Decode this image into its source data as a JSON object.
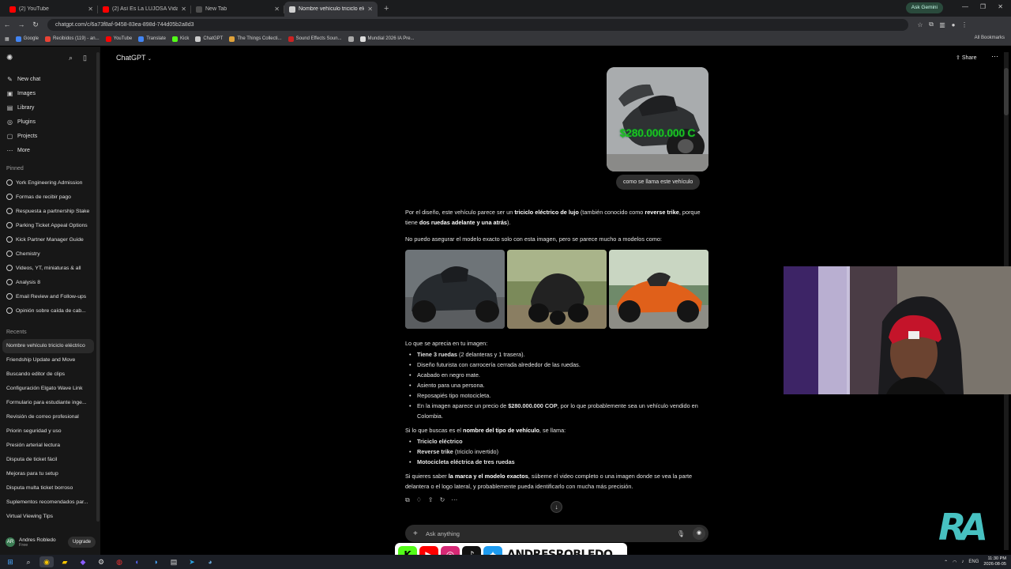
{
  "browser": {
    "tabs": [
      {
        "title": "(2) YouTube",
        "color": "#ff0000"
      },
      {
        "title": "(2) Así Es La LUJOSA Vida De...",
        "color": "#ff0000"
      },
      {
        "title": "New Tab",
        "color": "#4d4d4d"
      },
      {
        "title": "Nombre vehículo triciclo eléctr...",
        "color": "#d0d0d0",
        "active": true
      }
    ],
    "ask_gemini": "Ask Gemini",
    "url": "chatgpt.com/c/6a73f8af-9458-83ea-898d-744d05b2a8d3",
    "bookmarks": [
      {
        "label": "Google",
        "color": "#4285f4"
      },
      {
        "label": "Recibidos (119) - an...",
        "color": "#ea4335"
      },
      {
        "label": "YouTube",
        "color": "#ff0000"
      },
      {
        "label": "Translate",
        "color": "#4285f4"
      },
      {
        "label": "Kick",
        "color": "#53fc18"
      },
      {
        "label": "ChatGPT",
        "color": "#cccccc"
      },
      {
        "label": "The Things Collecti...",
        "color": "#e0a23a"
      },
      {
        "label": "Sound Effects Soun...",
        "color": "#cc2222"
      },
      {
        "label": "",
        "color": "#aaaaaa"
      },
      {
        "label": "Mundial 2026 IA Pre...",
        "color": "#dddddd"
      }
    ],
    "all_bookmarks": "All Bookmarks"
  },
  "sidebar": {
    "nav": [
      {
        "label": "New chat",
        "icon": "✎"
      },
      {
        "label": "Images",
        "icon": "▣"
      },
      {
        "label": "Library",
        "icon": "▤"
      },
      {
        "label": "Plugins",
        "icon": "◎"
      },
      {
        "label": "Projects",
        "icon": "▢"
      },
      {
        "label": "More",
        "icon": "⋯"
      }
    ],
    "pinned_heading": "Pinned",
    "pinned": [
      "York Engineering Admission",
      "Formas de recibir pago",
      "Respuesta a partnership Stake",
      "Parking Ticket Appeal Options",
      "Kick Partner Manager Guide",
      "Chemistry",
      "Videos, YT, miniaturas & all",
      "Analysis 8",
      "Email Review and Follow-ups",
      "Opinión sobre caída de cab..."
    ],
    "recents_heading": "Recents",
    "recents": [
      "Nombre vehículo triciclo eléctrico",
      "Friendship Update and Move",
      "Buscando editor de clips",
      "Configuración Elgato Wave Link",
      "Formulario para estudiante inge...",
      "Revisión de correo profesional",
      "Priorin seguridad y uso",
      "Presión arterial lectura",
      "Disputa de ticket fácil",
      "Mejoras para tu setup",
      "Disputa multa ticket borroso",
      "Suplementos recomendados par...",
      "Virtual Viewing Tips"
    ],
    "user": {
      "name": "Andres Robledo",
      "plan": "Free",
      "initials": "AR",
      "upgrade": "Upgrade"
    }
  },
  "header": {
    "model": "ChatGPT",
    "share": "Share"
  },
  "chat": {
    "image_price": "$280.000.000 C",
    "user_message": "como se llama este vehículo",
    "p1": [
      {
        "t": "Por el diseño, este vehículo parece ser un ",
        "b": false
      },
      {
        "t": "triciclo eléctrico de lujo",
        "b": true
      },
      {
        "t": " (también conocido como ",
        "b": false
      },
      {
        "t": "reverse trike",
        "b": true
      },
      {
        "t": ", porque tiene ",
        "b": false
      },
      {
        "t": "dos ruedas adelante y una atrás",
        "b": true
      },
      {
        "t": ").",
        "b": false
      }
    ],
    "p2": "No puedo asegurar el modelo exacto solo con esta imagen, pero se parece mucho a modelos como:",
    "p3": "Lo que se aprecia en tu imagen:",
    "features": [
      [
        {
          "t": "Tiene ",
          "b": true
        },
        {
          "t": "3 ruedas",
          "b": true
        },
        {
          "t": " (2 delanteras y 1 trasera).",
          "b": false
        }
      ],
      [
        {
          "t": "Diseño futurista con carrocería cerrada alrededor de las ruedas.",
          "b": false
        }
      ],
      [
        {
          "t": "Acabado en negro mate.",
          "b": false
        }
      ],
      [
        {
          "t": "Asiento para una persona.",
          "b": false
        }
      ],
      [
        {
          "t": "Reposapiés tipo motocicleta.",
          "b": false
        }
      ],
      [
        {
          "t": "En la imagen aparece un precio de ",
          "b": false
        },
        {
          "t": "$280.000.000 COP",
          "b": true
        },
        {
          "t": ", por lo que probablemente sea un vehículo vendido en Colombia.",
          "b": false
        }
      ]
    ],
    "p4": [
      {
        "t": "Si lo que buscas es el ",
        "b": false
      },
      {
        "t": "nombre del tipo de vehículo",
        "b": true
      },
      {
        "t": ", se llama:",
        "b": false
      }
    ],
    "names": [
      [
        {
          "t": "Triciclo eléctrico",
          "b": true
        }
      ],
      [
        {
          "t": "Reverse trike",
          "b": true
        },
        {
          "t": " (triciclo invertido)",
          "b": false
        }
      ],
      [
        {
          "t": "Motocicleta eléctrica de tres ruedas",
          "b": true
        }
      ]
    ],
    "p5": [
      {
        "t": "Si quieres saber ",
        "b": false
      },
      {
        "t": "la marca y el modelo exactos",
        "b": true
      },
      {
        "t": ", súbeme el video completo o una imagen donde se vea la parte delantera o el logo lateral, y probablemente pueda identificarlo con mucha más precisión.",
        "b": false
      }
    ]
  },
  "composer": {
    "placeholder": "Ask anything"
  },
  "overlay": {
    "handle": "ANDRESROBLEDO",
    "watermark": "RA"
  },
  "taskbar": {
    "lang": "ENG",
    "time": "11:30 PM",
    "date": "2026-08-05"
  }
}
